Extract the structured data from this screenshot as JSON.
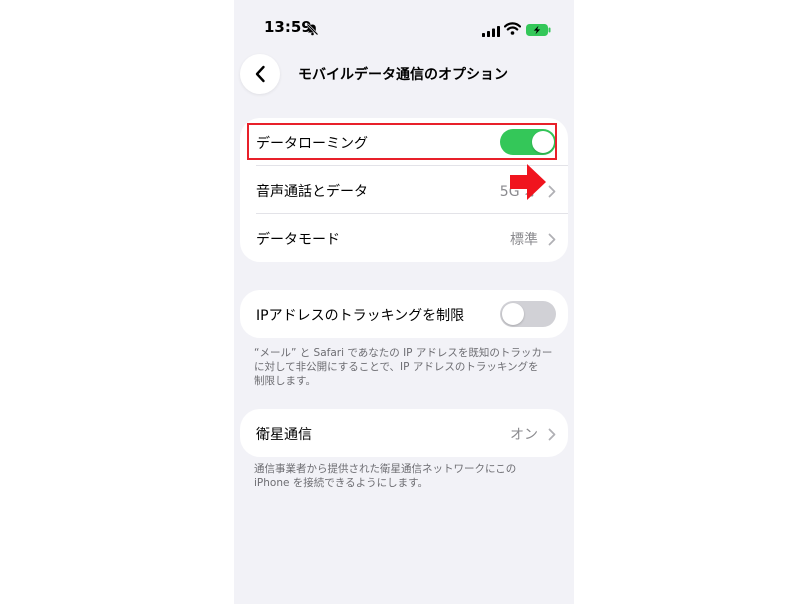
{
  "status_bar": {
    "time": "13:59",
    "icons": [
      "bell-slash-icon",
      "cellular-signal-icon",
      "wifi-icon",
      "battery-charging-icon"
    ]
  },
  "nav": {
    "back_icon": "chevron-left-icon",
    "title": "モバイルデータ通信のオプション"
  },
  "group1": {
    "data_roaming": {
      "label": "データローミング",
      "toggle_on": true
    },
    "voice_data": {
      "label": "音声通話とデータ",
      "value": "5G オ"
    },
    "data_mode": {
      "label": "データモード",
      "value": "標準"
    }
  },
  "group2": {
    "ip_tracking": {
      "label": "IPアドレスのトラッキングを制限",
      "toggle_on": false
    },
    "footnote_line1": "“メール” と Safari であなたの IP アドレスを既知のトラッカー",
    "footnote_line2": "に対して非公開にすることで、IP アドレスのトラッキングを",
    "footnote_line3": "制限します。"
  },
  "group3": {
    "satellite": {
      "label": "衛星通信",
      "value": "オン"
    },
    "footnote_line1": "通信事業者から提供された衛星通信ネットワークにこの",
    "footnote_line2": "iPhone を接続できるようにします。"
  },
  "colors": {
    "toggle_on": "#34c759",
    "toggle_off": "#d1d1d6",
    "highlight": "#e8202a",
    "background": "#f2f2f7"
  }
}
